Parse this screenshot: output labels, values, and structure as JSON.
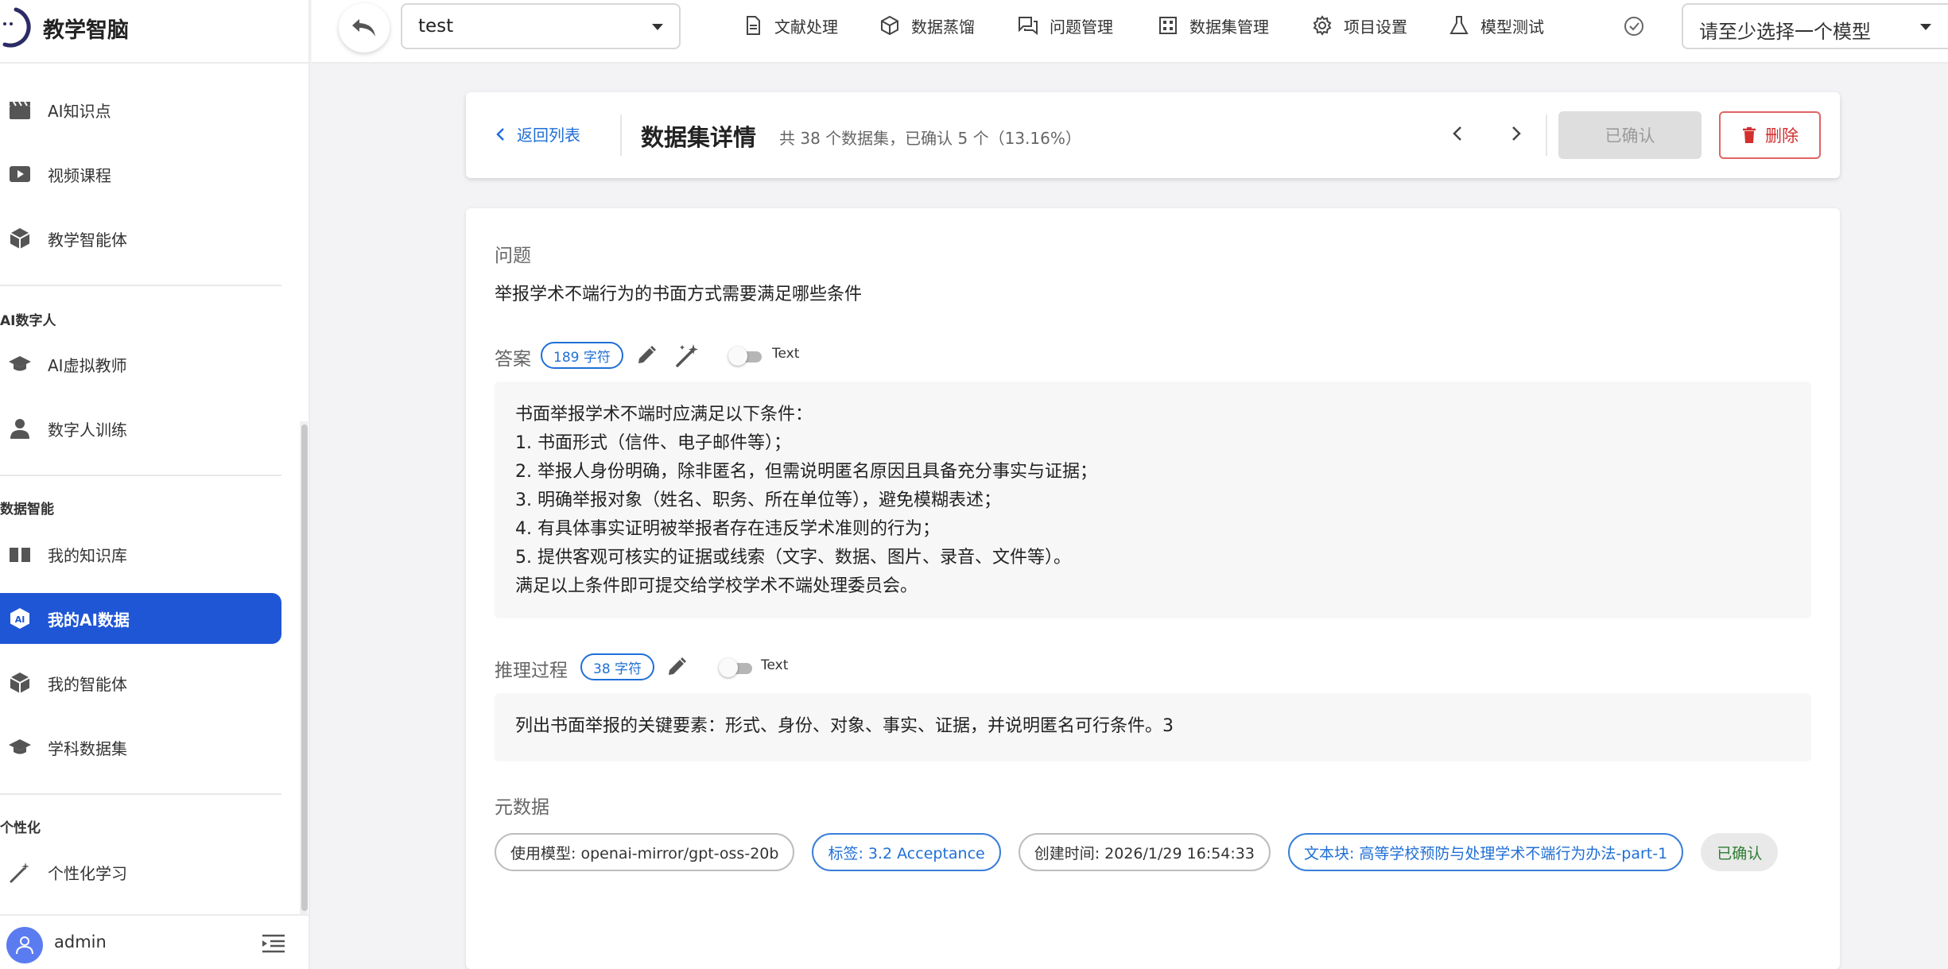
{
  "colors": {
    "primary": "#1f56d6",
    "link": "#1f6fd6",
    "danger": "#d32f2f",
    "success": "#2e7d32",
    "disabled_bg": "#dedede"
  },
  "brand": {
    "title": "教学智脑",
    "logo_icon": "brand-logo-icon"
  },
  "sidebar": {
    "items_top": [
      {
        "label": "AI知识点",
        "icon": "clapperboard-icon"
      },
      {
        "label": "视频课程",
        "icon": "video-play-icon"
      },
      {
        "label": "教学智能体",
        "icon": "hexagon-box-icon"
      }
    ],
    "section_digital_human": {
      "title": "AI数字人",
      "items": [
        {
          "label": "AI虚拟教师",
          "icon": "graduation-cap-icon"
        },
        {
          "label": "数字人训练",
          "icon": "person-icon"
        }
      ]
    },
    "section_data": {
      "title": "数据智能",
      "items": [
        {
          "label": "我的知识库",
          "icon": "open-book-icon"
        },
        {
          "label": "我的AI数据",
          "icon": "ai-cube-icon",
          "active": true
        },
        {
          "label": "我的智能体",
          "icon": "hexagon-box-icon"
        },
        {
          "label": "学科数据集",
          "icon": "graduation-cap-icon"
        }
      ]
    },
    "section_personal": {
      "title": "个性化",
      "items": [
        {
          "label": "个性化学习",
          "icon": "magic-wand-icon"
        }
      ]
    },
    "user": {
      "name": "admin"
    }
  },
  "topbar": {
    "project": "test",
    "menu": [
      {
        "label": "文献处理",
        "icon": "document-icon"
      },
      {
        "label": "数据蒸馏",
        "icon": "cube-icon"
      },
      {
        "label": "问题管理",
        "icon": "chat-icon"
      },
      {
        "label": "数据集管理",
        "icon": "grid-icon"
      },
      {
        "label": "项目设置",
        "icon": "gear-icon"
      },
      {
        "label": "模型测试",
        "icon": "flask-icon"
      }
    ],
    "model_placeholder": "请至少选择一个模型"
  },
  "header": {
    "back_label": "返回列表",
    "title": "数据集详情",
    "summary": "共 38 个数据集，已确认 5 个（13.16%）",
    "confirmed_label": "已确认",
    "delete_label": "删除"
  },
  "detail": {
    "question_label": "问题",
    "question": "举报学术不端行为的书面方式需要满足哪些条件",
    "answer_label": "答案",
    "answer_count": "189 字符",
    "answer_toggle_label": "Text",
    "answer_lines": [
      "书面举报学术不端时应满足以下条件：",
      "1. 书面形式（信件、电子邮件等）；",
      "2. 举报人身份明确，除非匿名，但需说明匿名原因且具备充分事实与证据；",
      "3. 明确举报对象（姓名、职务、所在单位等），避免模糊表述；",
      "4. 有具体事实证明被举报者存在违反学术准则的行为；",
      "5. 提供客观可核实的证据或线索（文字、数据、图片、录音、文件等）。",
      "满足以上条件即可提交给学校学术不端处理委员会。"
    ],
    "reasoning_label": "推理过程",
    "reasoning_count": "38 字符",
    "reasoning_toggle_label": "Text",
    "reasoning": "列出书面举报的关键要素：形式、身份、对象、事实、证据，并说明匿名可行条件。3",
    "metadata_label": "元数据",
    "metadata": {
      "model": "使用模型: openai-mirror/gpt-oss-20b",
      "tag": "标签: 3.2 Acceptance",
      "created": "创建时间: 2026/1/29 16:54:33",
      "chunk": "文本块: 高等学校预防与处理学术不端行为办法-part-1",
      "status": "已确认"
    }
  }
}
